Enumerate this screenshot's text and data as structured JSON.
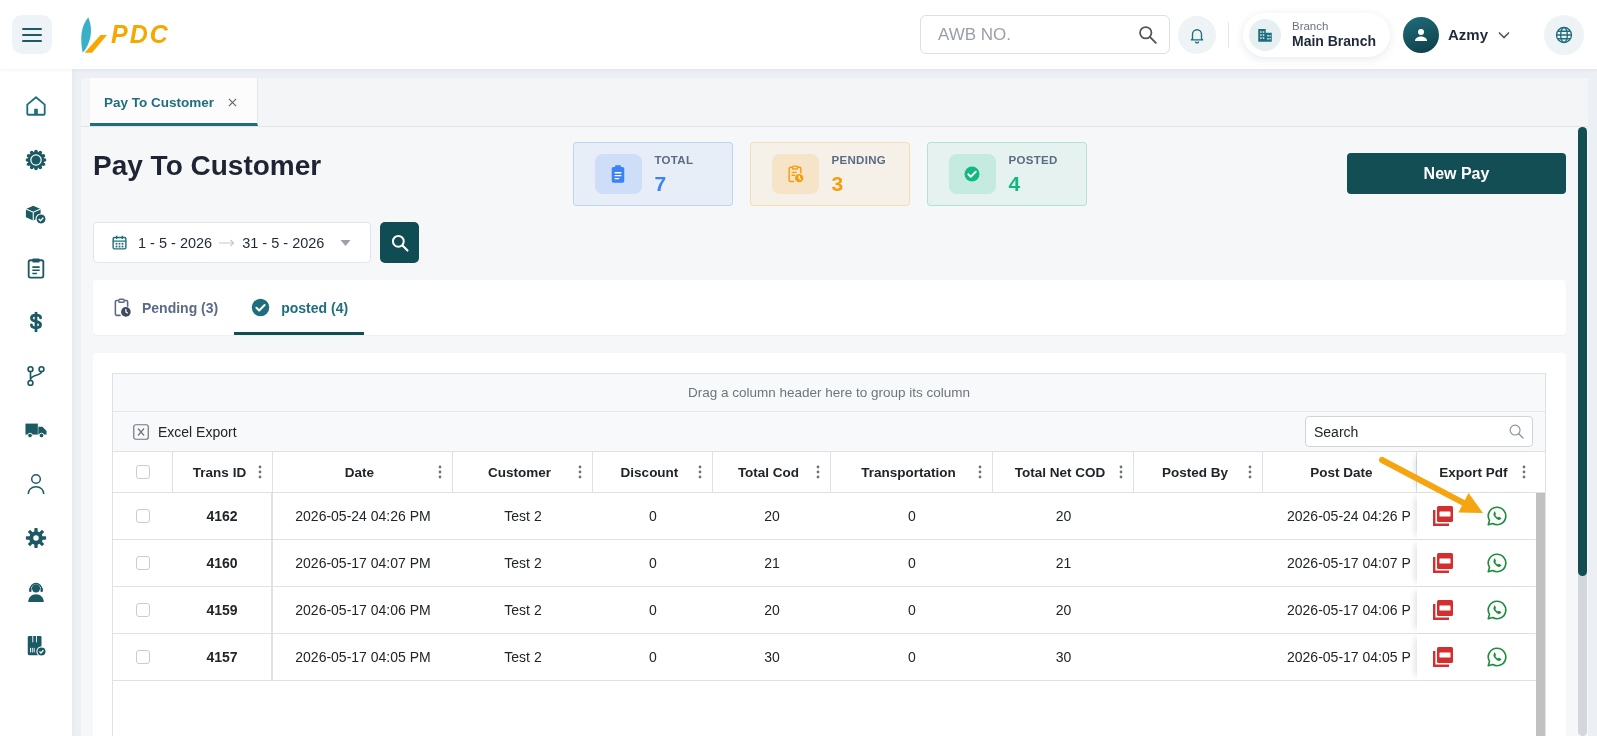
{
  "annotation": {
    "kind": "arrow"
  },
  "top_bar": {
    "logo_text": "PDC",
    "search": {
      "placeholder": "AWB NO."
    },
    "branch": {
      "label": "Branch",
      "value": "Main Branch"
    },
    "user": {
      "name": "Azmy"
    }
  },
  "sidebar": {
    "items": [
      {
        "kind": "home"
      },
      {
        "kind": "badge"
      },
      {
        "kind": "boxes"
      },
      {
        "kind": "clipboard"
      },
      {
        "kind": "dollar"
      },
      {
        "kind": "branch"
      },
      {
        "kind": "truck"
      },
      {
        "kind": "user"
      },
      {
        "kind": "settings"
      },
      {
        "kind": "agent"
      },
      {
        "kind": "package"
      }
    ]
  },
  "tabs": [
    {
      "label": "Pay To Customer",
      "selected": true
    }
  ],
  "page": {
    "title": "Pay To Customer",
    "stats": [
      {
        "kind": "total",
        "label": "TOTAL",
        "value": "7",
        "color": "#3b82f6"
      },
      {
        "kind": "pending",
        "label": "PENDING",
        "value": "3",
        "color": "#f59e0b"
      },
      {
        "kind": "posted",
        "label": "POSTED",
        "value": "4",
        "color": "#10b981"
      }
    ],
    "new_button": "New Pay",
    "date_range": {
      "start": "1 - 5 - 2026",
      "end": "31 - 5 - 2026"
    },
    "status_tabs": [
      {
        "kind": "pending",
        "label": "Pending (3)",
        "selected": false
      },
      {
        "kind": "posted",
        "label": "posted (4)",
        "selected": true
      }
    ]
  },
  "grid": {
    "group_hint": "Drag a column header here to group its column",
    "excel_export": "Excel Export",
    "search": {
      "placeholder": "Search"
    },
    "select_all": {
      "checked": false
    },
    "columns": [
      {
        "label": "Trans ID",
        "menu": true
      },
      {
        "label": "Date",
        "menu": true
      },
      {
        "label": "Customer",
        "menu": true
      },
      {
        "label": "Discount",
        "menu": true
      },
      {
        "label": "Total Cod",
        "menu": true
      },
      {
        "label": "Transportation",
        "menu": true
      },
      {
        "label": "Total Net COD",
        "menu": true
      },
      {
        "label": "Posted By",
        "menu": true
      },
      {
        "label": "Post Date",
        "menu": false
      },
      {
        "label": "Export Pdf",
        "menu": true
      }
    ],
    "rows": [
      {
        "checked": false,
        "trans_id": "4162",
        "date": "2026-05-24 04:26 PM",
        "customer": "Test 2",
        "discount": "0",
        "total_cod": "20",
        "transportation": "0",
        "total_net_cod": "20",
        "post_date": "2026-05-24 04:26 P"
      },
      {
        "checked": false,
        "trans_id": "4160",
        "date": "2026-05-17 04:07 PM",
        "customer": "Test 2",
        "discount": "0",
        "total_cod": "21",
        "transportation": "0",
        "total_net_cod": "21",
        "post_date": "2026-05-17 04:07 P"
      },
      {
        "checked": false,
        "trans_id": "4159",
        "date": "2026-05-17 04:06 PM",
        "customer": "Test 2",
        "discount": "0",
        "total_cod": "20",
        "transportation": "0",
        "total_net_cod": "20",
        "post_date": "2026-05-17 04:06 P"
      },
      {
        "checked": false,
        "trans_id": "4157",
        "date": "2026-05-17 04:05 PM",
        "customer": "Test 2",
        "discount": "0",
        "total_cod": "30",
        "transportation": "0",
        "total_net_cod": "30",
        "post_date": "2026-05-17 04:05 P"
      }
    ]
  }
}
